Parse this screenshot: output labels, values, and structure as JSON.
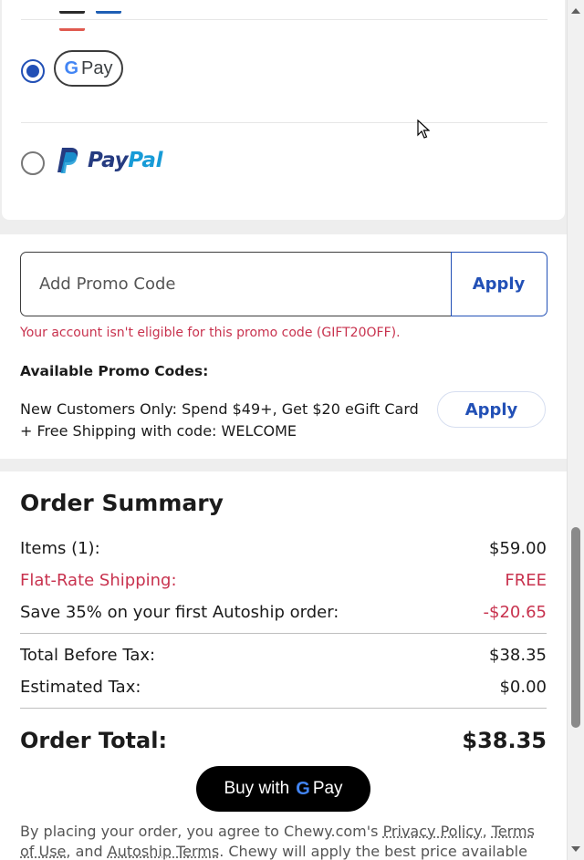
{
  "payment_methods": [
    {
      "name": "Google Pay",
      "logo_text": "Pay",
      "selected": true
    },
    {
      "name": "PayPal",
      "logo_text_a": "Pay",
      "logo_text_b": "Pal",
      "selected": false
    }
  ],
  "promo": {
    "placeholder": "Add Promo Code",
    "value": "",
    "apply_label": "Apply",
    "error": "Your account isn't eligible for this promo code (GIFT20OFF).",
    "available_label": "Available Promo Codes:",
    "available": [
      {
        "description": "New Customers Only: Spend $49+, Get $20 eGift Card + Free Shipping with code: WELCOME",
        "apply_label": "Apply"
      }
    ]
  },
  "summary": {
    "title": "Order Summary",
    "lines": [
      {
        "label": "Items (1):",
        "value": "$59.00"
      },
      {
        "label": "Flat-Rate Shipping:",
        "value": "FREE"
      },
      {
        "label": "Save 35% on your first Autoship order:",
        "value": "-$20.65"
      },
      {
        "label": "Total Before Tax:",
        "value": "$38.35"
      },
      {
        "label": "Estimated Tax:",
        "value": "$0.00"
      }
    ],
    "total_label": "Order Total:",
    "total_value": "$38.35",
    "buy_prefix": "Buy with",
    "buy_pay": "Pay",
    "legal": {
      "pre": "By placing your order, you agree to Chewy.com's ",
      "privacy": "Privacy Policy",
      "comma": ", ",
      "terms": "Terms of Use",
      "and": ", and ",
      "autoship": "Autoship Terms",
      "post": ". Chewy will apply the best price available"
    }
  },
  "colors": {
    "accent_blue": "#2250b6",
    "error_red": "#c8324e",
    "paypal_dark": "#253b80",
    "paypal_light": "#179bd7"
  }
}
